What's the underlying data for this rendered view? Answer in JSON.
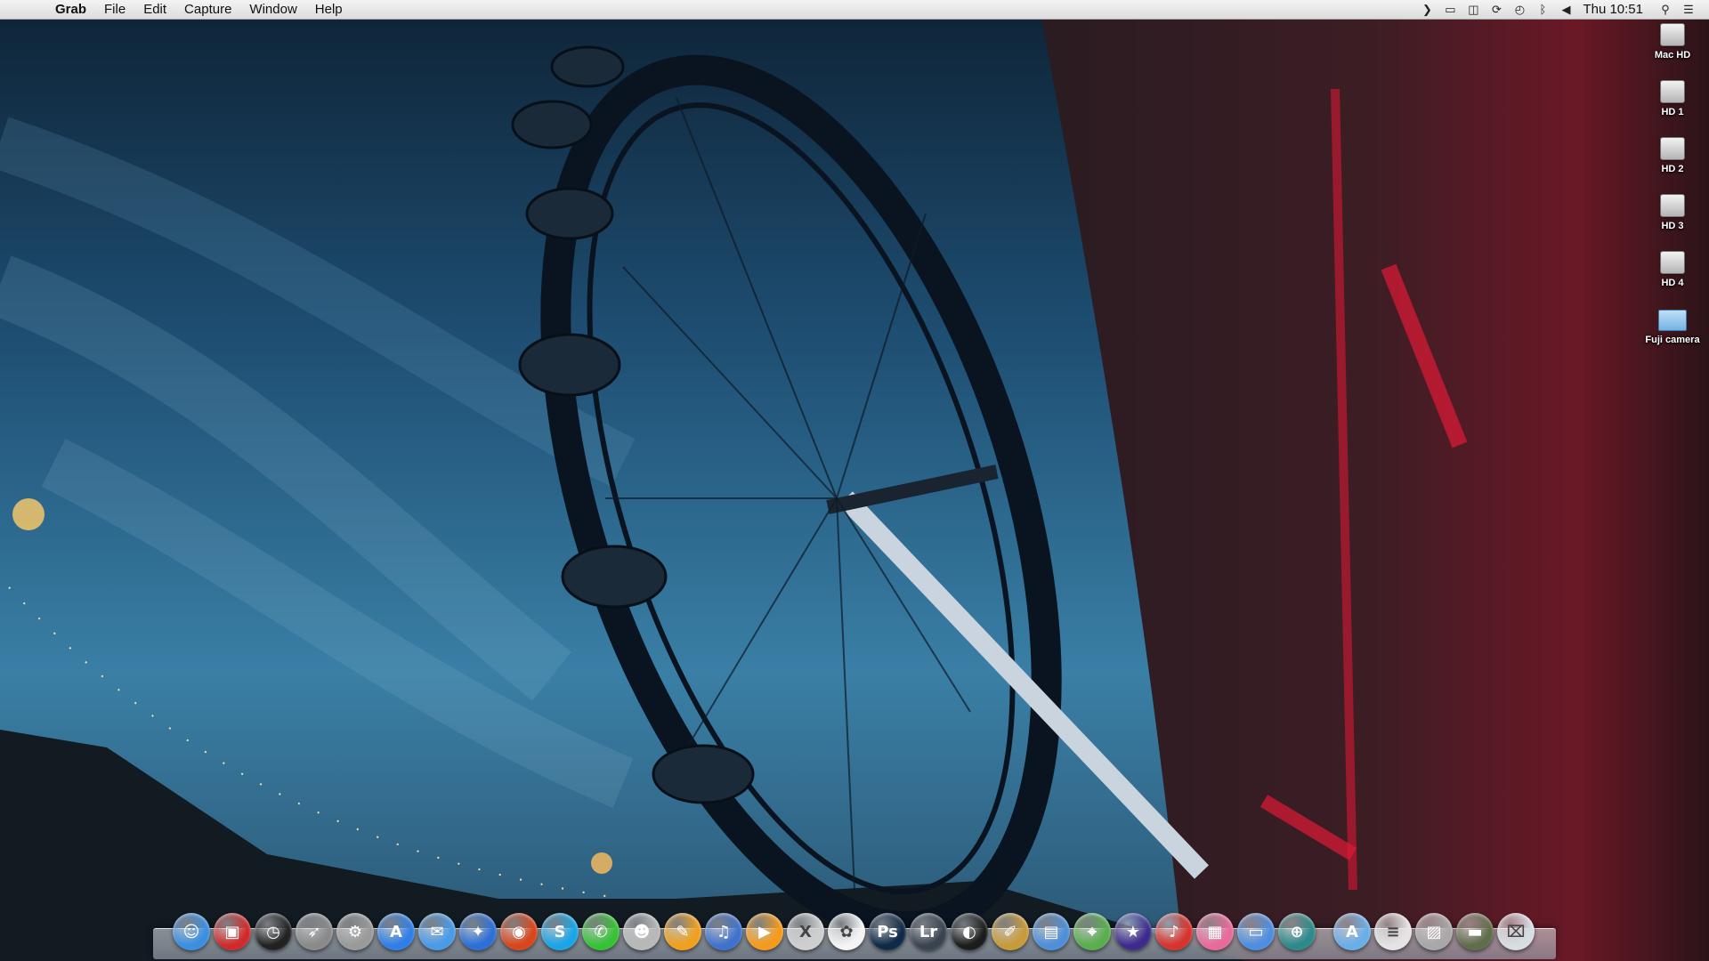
{
  "menubar": {
    "app_name": "Grab",
    "menus": [
      "File",
      "Edit",
      "Capture",
      "Window",
      "Help"
    ],
    "status_icons": [
      "chevron-right",
      "airplay",
      "screen",
      "sync",
      "time-machine",
      "bluetooth",
      "volume"
    ],
    "clock": "Thu 10:51"
  },
  "desktop_icons": [
    {
      "label": "Mac HD",
      "kind": "drive"
    },
    {
      "label": "HD 1",
      "kind": "drive"
    },
    {
      "label": "HD 2",
      "kind": "drive"
    },
    {
      "label": "HD 3",
      "kind": "drive"
    },
    {
      "label": "HD 4",
      "kind": "drive"
    },
    {
      "label": "Fuji camera",
      "kind": "folder"
    }
  ],
  "dock": {
    "apps": [
      {
        "icon": "finder-icon",
        "glyph": "☺",
        "color": "#3a8fe0"
      },
      {
        "icon": "photo-booth-icon",
        "glyph": "▣",
        "color": "#d02a2a"
      },
      {
        "icon": "clock-icon",
        "glyph": "◷",
        "color": "#222222"
      },
      {
        "icon": "launchpad-icon",
        "glyph": "➶",
        "color": "#8a8a8a"
      },
      {
        "icon": "system-preferences-icon",
        "glyph": "⚙",
        "color": "#9a9a9a"
      },
      {
        "icon": "app-store-icon",
        "glyph": "A",
        "color": "#2f7fe8"
      },
      {
        "icon": "mail-icon",
        "glyph": "✉",
        "color": "#4a9ae8"
      },
      {
        "icon": "safari-icon",
        "glyph": "✦",
        "color": "#2d6fd6"
      },
      {
        "icon": "firefox-icon",
        "glyph": "◉",
        "color": "#d8461c"
      },
      {
        "icon": "skype-icon",
        "glyph": "S",
        "color": "#1aa5e6"
      },
      {
        "icon": "messages-icon",
        "glyph": "✆",
        "color": "#37c236"
      },
      {
        "icon": "contacts-icon",
        "glyph": "☻",
        "color": "#b8b8b8"
      },
      {
        "icon": "pages-icon",
        "glyph": "✎",
        "color": "#f0a01e"
      },
      {
        "icon": "itunes-icon",
        "glyph": "♫",
        "color": "#3f72cc"
      },
      {
        "icon": "infuse-icon",
        "glyph": "▶",
        "color": "#f59a1a"
      },
      {
        "icon": "textedit-icon",
        "glyph": "X",
        "color": "#cfcfcf"
      },
      {
        "icon": "photos-icon",
        "glyph": "✿",
        "color": "#f4f4f4"
      },
      {
        "icon": "photoshop-icon",
        "glyph": "Ps",
        "color": "#0f2a46"
      },
      {
        "icon": "lightroom-icon",
        "glyph": "Lr",
        "color": "#3a4450"
      },
      {
        "icon": "aperture-icon",
        "glyph": "◐",
        "color": "#1c1c1c"
      },
      {
        "icon": "image-editor-icon",
        "glyph": "✐",
        "color": "#c89b3a"
      },
      {
        "icon": "preview-icon",
        "glyph": "▤",
        "color": "#4f8fd8"
      },
      {
        "icon": "maps-icon",
        "glyph": "⌖",
        "color": "#5aae4e"
      },
      {
        "icon": "imovie-icon",
        "glyph": "★",
        "color": "#3d2a8c"
      },
      {
        "icon": "garageband-icon",
        "glyph": "♪",
        "color": "#d8332d"
      },
      {
        "icon": "color-utility-icon",
        "glyph": "▦",
        "color": "#e86a9a"
      },
      {
        "icon": "keynote-icon",
        "glyph": "▭",
        "color": "#4d8ee0"
      },
      {
        "icon": "network-utility-icon",
        "glyph": "⊕",
        "color": "#2d8a8a"
      }
    ],
    "stacks": [
      {
        "icon": "applications-folder-icon",
        "glyph": "A",
        "color": "#6aaee8"
      },
      {
        "icon": "documents-stack-icon",
        "glyph": "≡",
        "color": "#e4e4e4"
      },
      {
        "icon": "pictures-stack-icon",
        "glyph": "▨",
        "color": "#a8a8a8"
      },
      {
        "icon": "downloads-stack-icon",
        "glyph": "▬",
        "color": "#5f6d4a"
      },
      {
        "icon": "trash-icon",
        "glyph": "⌧",
        "color": "#d8dde2"
      }
    ]
  }
}
